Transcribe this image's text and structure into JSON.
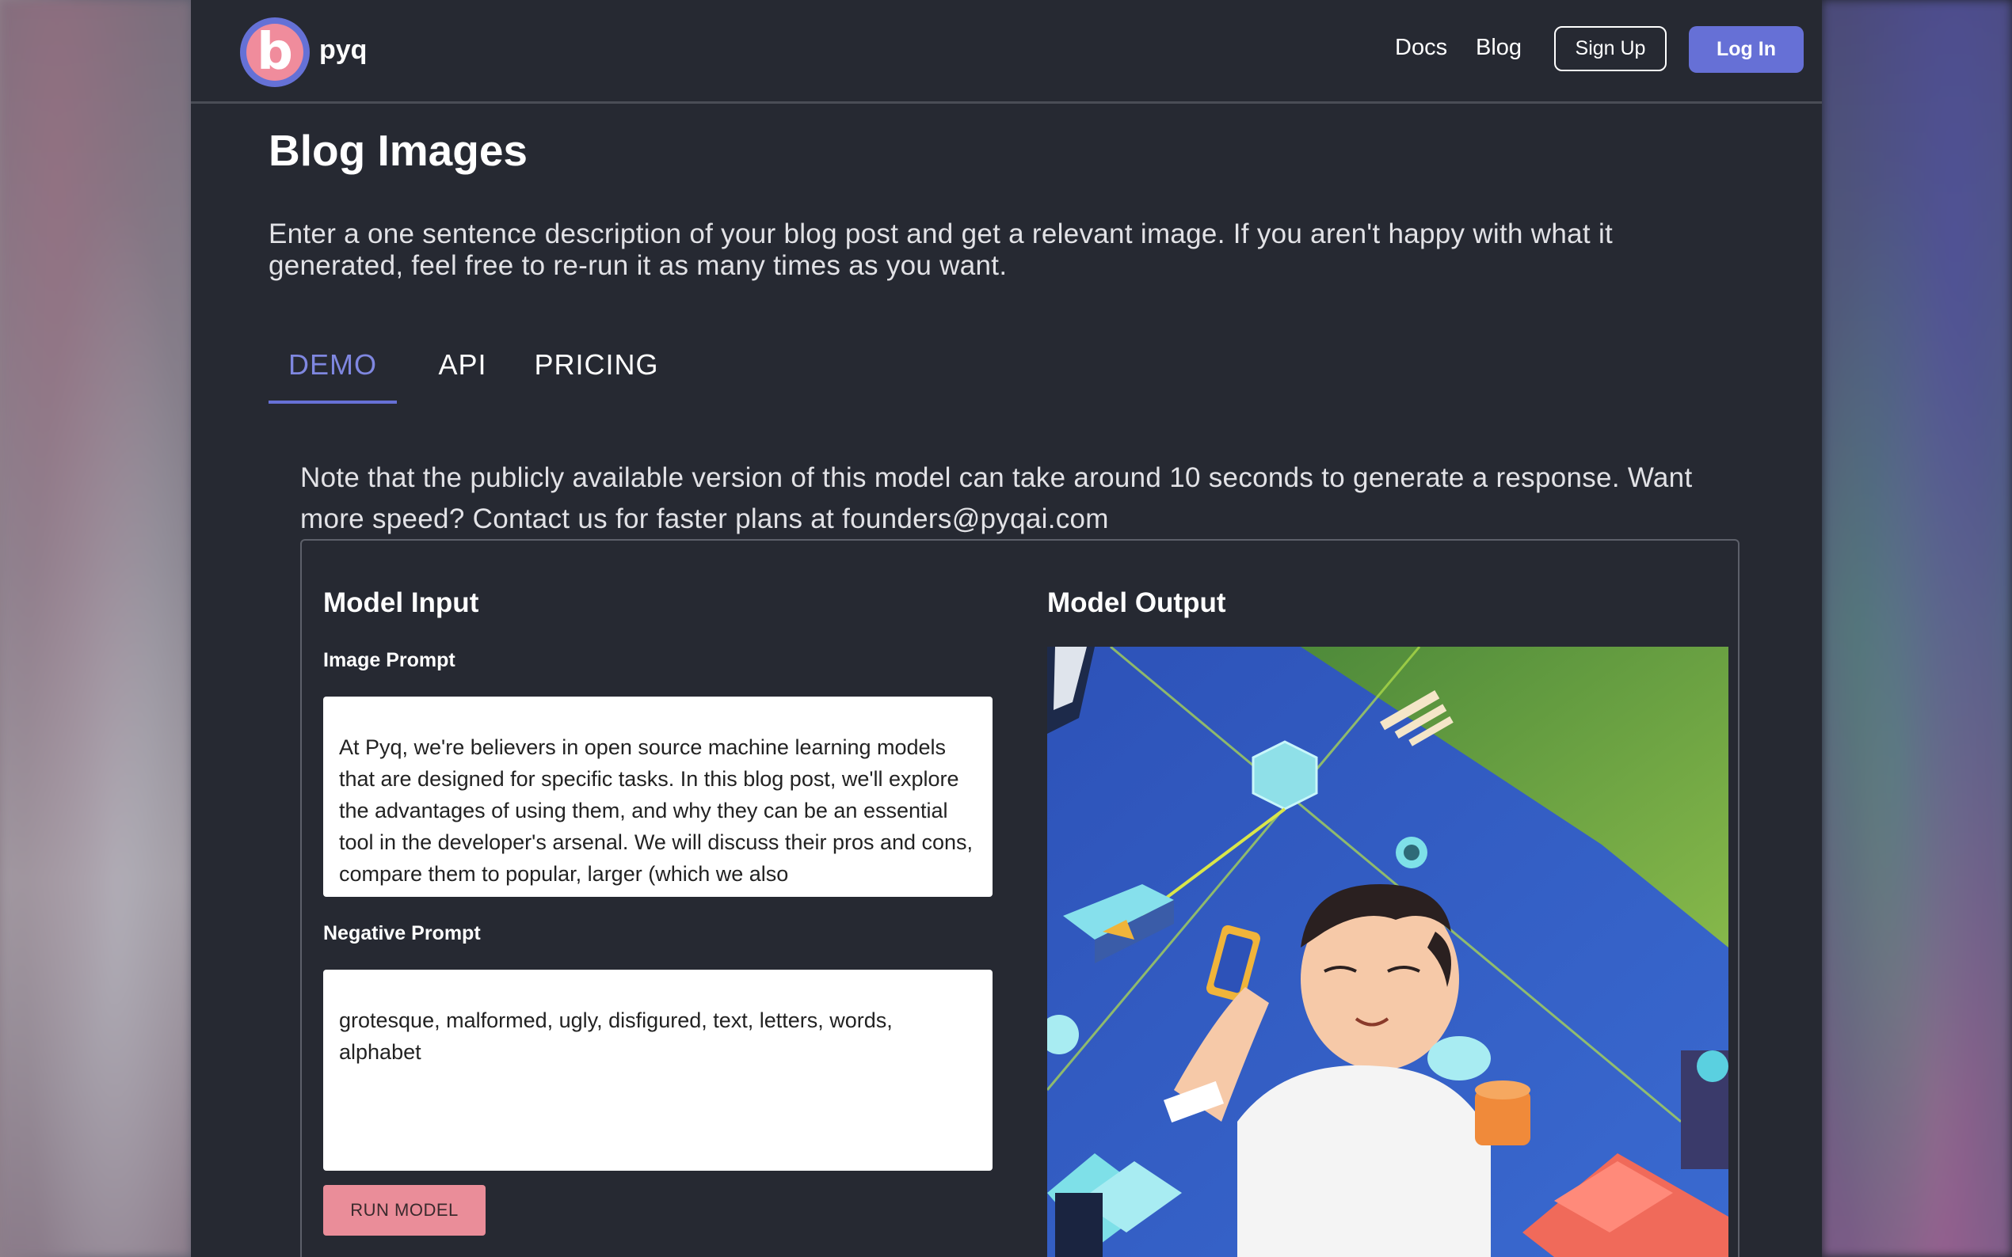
{
  "nav": {
    "logo_letter": "b",
    "brand": "pyq",
    "links": [
      "Docs",
      "Blog"
    ],
    "signup_label": "Sign Up",
    "login_label": "Log In",
    "accent_color": "#6670d6"
  },
  "page": {
    "title": "Blog Images",
    "description": "Enter a one sentence description of your blog post and get a relevant image. If you aren't happy with what it generated, feel free to re-run it as many times as you want."
  },
  "tabs": [
    {
      "label": "DEMO",
      "active": true
    },
    {
      "label": "API",
      "active": false
    },
    {
      "label": "PRICING",
      "active": false
    }
  ],
  "note": "Note that the publicly available version of this model can take around 10 seconds to generate a response. Want more speed? Contact us for faster plans at founders@pyqai.com",
  "model_input": {
    "title": "Model Input",
    "image_prompt_label": "Image Prompt",
    "image_prompt_value": "At Pyq, we're believers in open source machine learning models that are designed for specific tasks. In this blog post, we'll explore the advantages of using them, and why they can be an essential tool in the developer's arsenal. We will discuss their pros and cons, compare them to popular, larger (which we also",
    "negative_prompt_label": "Negative Prompt",
    "negative_prompt_value": "grotesque, malformed, ugly, disfigured, text, letters, words, alphabet",
    "run_label": "RUN MODEL",
    "run_color": "#ea8d99"
  },
  "model_output": {
    "title": "Model Output",
    "image": "isometric-illustration-man-with-phone"
  }
}
